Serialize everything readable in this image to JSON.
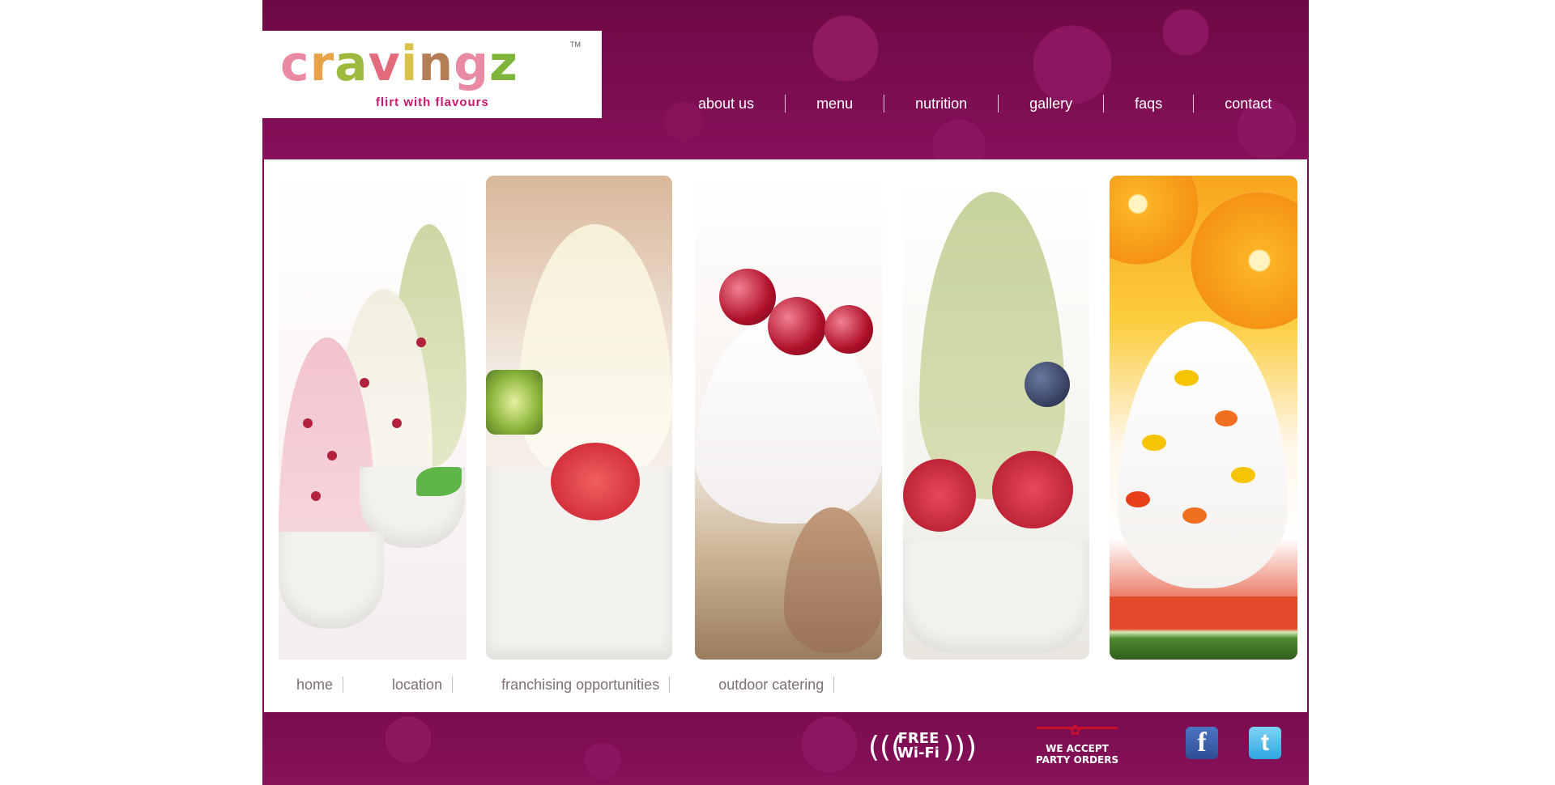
{
  "logo": {
    "word": "cravingz",
    "tm": "TM",
    "tagline": "flirt with flavours"
  },
  "nav": {
    "items": [
      "about us",
      "menu",
      "nutrition",
      "gallery",
      "faqs",
      "contact"
    ]
  },
  "subnav": {
    "items": [
      "home",
      "location",
      "franchising opportunities",
      "outdoor catering"
    ]
  },
  "footer": {
    "wifi": {
      "line1": "FREE",
      "line2": "Wi-Fi"
    },
    "party": {
      "line1": "WE ACCEPT",
      "line2": "PARTY ORDERS"
    },
    "facebook": "f",
    "twitter": "t"
  },
  "colors": {
    "brand": "#7a0a4d",
    "tagline": "#c8186d"
  }
}
